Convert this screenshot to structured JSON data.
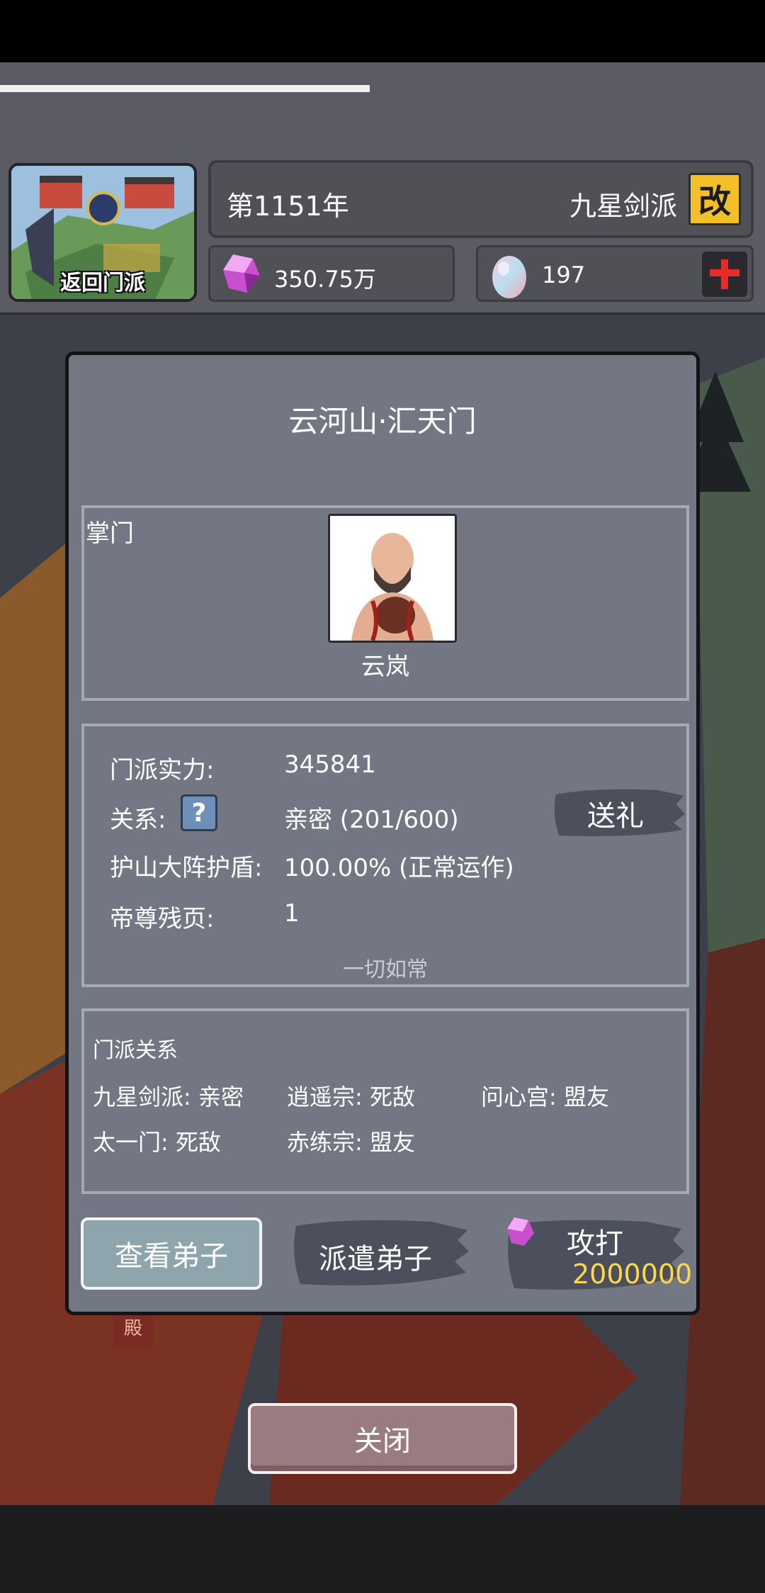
{
  "top": {
    "return_label": "返回门派",
    "year": "第1151年",
    "sect_name": "九星剑派",
    "rename_glyph": "改",
    "spirit_stones": "350.75万",
    "eggs": "197"
  },
  "dialog": {
    "title": "云河山·汇天门",
    "leader": {
      "label": "掌门",
      "name": "云岚"
    },
    "info": {
      "power_label": "门派实力:",
      "power_value": "345841",
      "relation_label": "关系:",
      "relation_value": "亲密  (201/600)",
      "shield_label": "护山大阵护盾:",
      "shield_value": "100.00% (正常运作)",
      "pages_label": "帝尊残页:",
      "pages_value": "1",
      "status_text": "一切如常",
      "gift_button": "送礼"
    },
    "relations": {
      "title": "门派关系",
      "items": [
        "九星剑派: 亲密",
        "逍遥宗: 死敌",
        "问心宫: 盟友",
        "太一门: 死敌",
        "赤练宗: 盟友"
      ]
    },
    "buttons": {
      "view": "查看弟子",
      "dispatch": "派遣弟子",
      "attack": "攻打",
      "attack_cost": "2000000"
    }
  },
  "close_button": "关闭",
  "scene_sign": "殿",
  "icons": [
    "gem-icon",
    "egg-icon",
    "plus-icon",
    "help-icon",
    "rename-icon"
  ],
  "colors": {
    "accent_yellow": "#f2c028",
    "cost_yellow": "#ffd84a",
    "dialog_bg": "#737783"
  }
}
